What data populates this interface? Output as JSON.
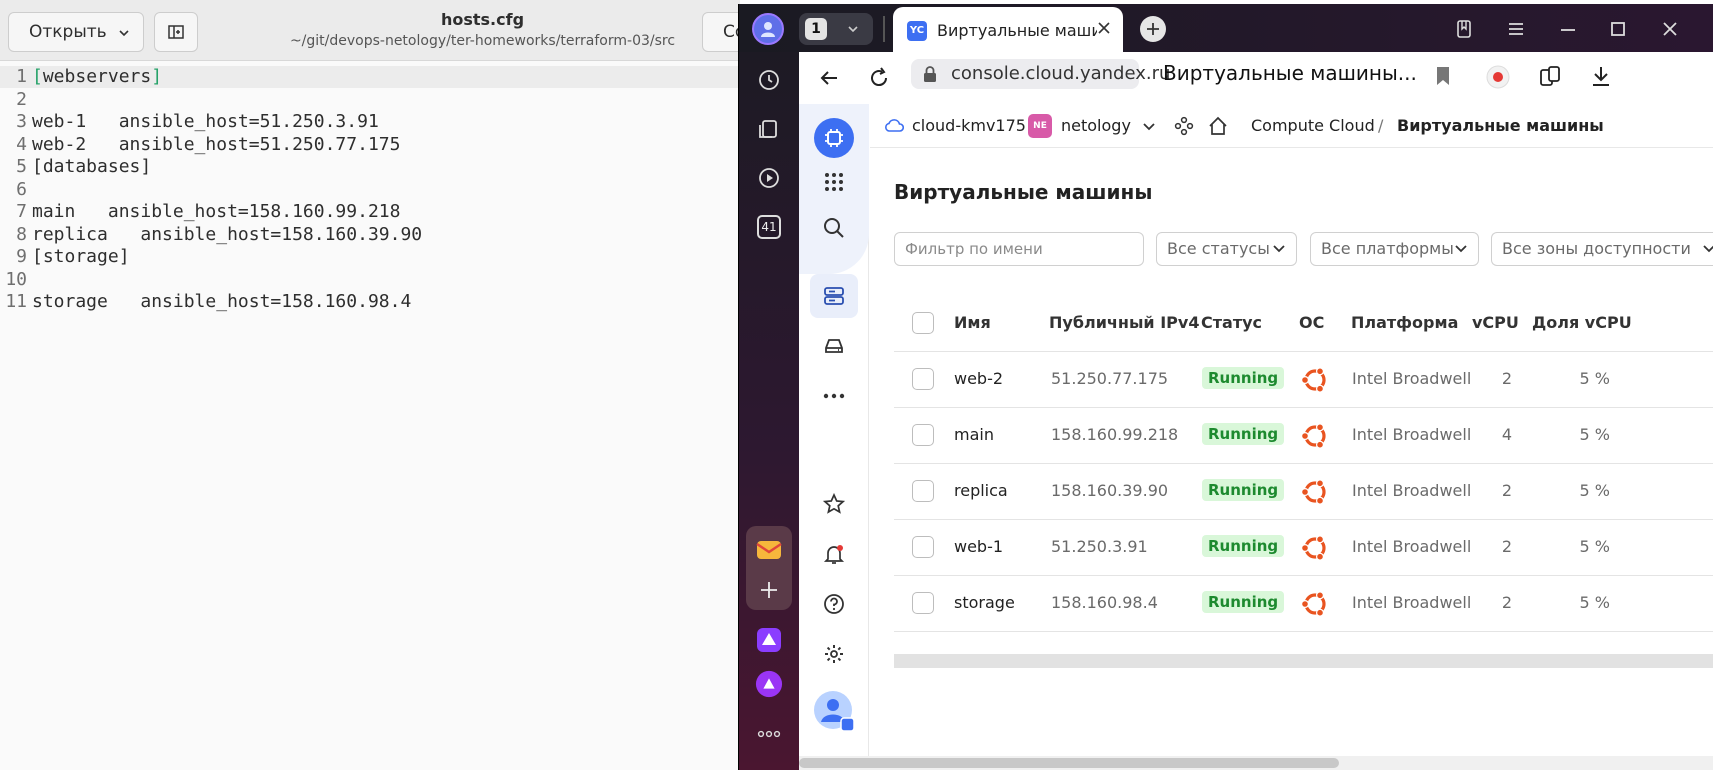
{
  "editor": {
    "open_label": "Открыть",
    "save_label": "Сохранить",
    "title": "hosts.cfg",
    "path": "~/git/devops-netology/ter-homeworks/terraform-03/src",
    "lines": [
      {
        "n": "1",
        "text": "[webservers]"
      },
      {
        "n": "2",
        "text": ""
      },
      {
        "n": "3",
        "text": "web-1   ansible_host=51.250.3.91"
      },
      {
        "n": "4",
        "text": "web-2   ansible_host=51.250.77.175"
      },
      {
        "n": "5",
        "text": "[databases]"
      },
      {
        "n": "6",
        "text": ""
      },
      {
        "n": "7",
        "text": "main   ansible_host=158.160.99.218"
      },
      {
        "n": "8",
        "text": "replica   ansible_host=158.160.39.90"
      },
      {
        "n": "9",
        "text": "[storage]"
      },
      {
        "n": "10",
        "text": ""
      },
      {
        "n": "11",
        "text": "storage   ansible_host=158.160.98.4"
      }
    ]
  },
  "browser": {
    "tab_count": "1",
    "tab": {
      "icon": "YC",
      "title": "Виртуальные машины"
    },
    "url": "console.cloud.yandex.ru",
    "page_title": "Виртуальные машины...",
    "sidebar_badge": "41"
  },
  "console": {
    "breadcrumb": {
      "cloud": "cloud-kmv175",
      "folder_badge": "NE",
      "folder": "netology",
      "service": "Compute Cloud",
      "separator": "/",
      "current": "Виртуальные машины"
    },
    "heading": "Виртуальные машины",
    "filters": {
      "name_placeholder": "Фильтр по имени",
      "status": "Все статусы",
      "platform": "Все платформы",
      "zone": "Все зоны доступности"
    },
    "table": {
      "headers": {
        "name": "Имя",
        "ip": "Публичный IPv4",
        "status": "Статус",
        "os": "ОС",
        "platform": "Платформа",
        "vcpu": "vCPU",
        "fraction": "Доля vCPU"
      },
      "rows": [
        {
          "name": "web-2",
          "ip": "51.250.77.175",
          "status": "Running",
          "platform": "Intel Broadwell",
          "vcpu": "2",
          "fraction": "5 %"
        },
        {
          "name": "main",
          "ip": "158.160.99.218",
          "status": "Running",
          "platform": "Intel Broadwell",
          "vcpu": "4",
          "fraction": "5 %"
        },
        {
          "name": "replica",
          "ip": "158.160.39.90",
          "status": "Running",
          "platform": "Intel Broadwell",
          "vcpu": "2",
          "fraction": "5 %"
        },
        {
          "name": "web-1",
          "ip": "51.250.3.91",
          "status": "Running",
          "platform": "Intel Broadwell",
          "vcpu": "2",
          "fraction": "5 %"
        },
        {
          "name": "storage",
          "ip": "158.160.98.4",
          "status": "Running",
          "platform": "Intel Broadwell",
          "vcpu": "2",
          "fraction": "5 %"
        }
      ]
    }
  },
  "colors": {
    "running_bg": "#d9f7d9",
    "running_text": "#1d8a2f",
    "ubuntu": "#e95420",
    "accent": "#3d6ff2",
    "bracket_green": "#26a269"
  }
}
